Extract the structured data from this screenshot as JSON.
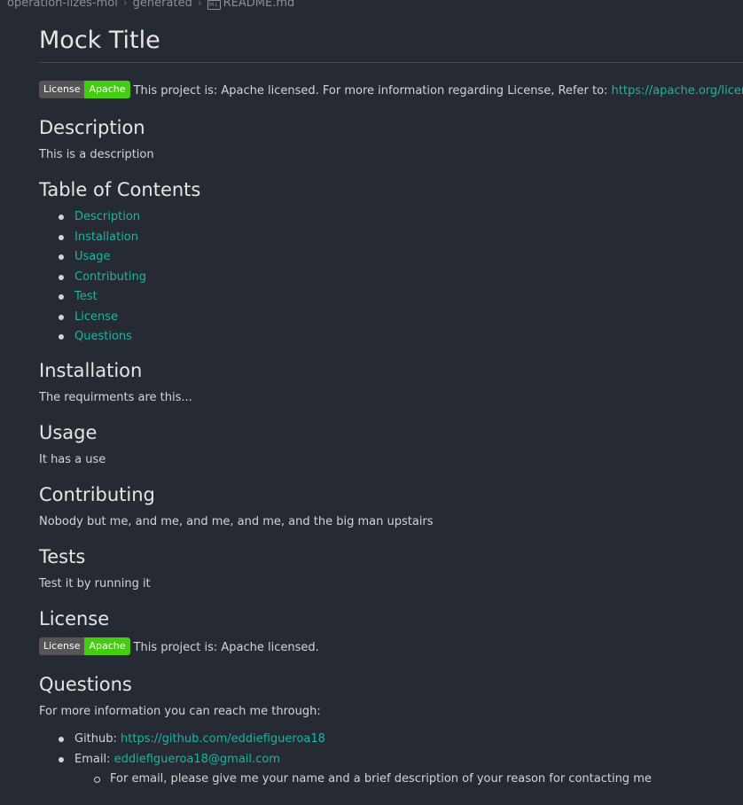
{
  "breadcrumb": {
    "folder1": "operation-lizes-moi",
    "folder2": "generated",
    "file_icon": "M↓",
    "file": "README.md"
  },
  "doc": {
    "title": "Mock Title",
    "badge": {
      "left": "License",
      "right": "Apache"
    },
    "license_intro": "This project is: Apache licensed. For more information regarding License, Refer to:",
    "license_link": "https://apache.org/licenses/",
    "description_heading": "Description",
    "description_text": "This is a description",
    "toc_heading": "Table of Contents",
    "toc": [
      "Description",
      "Installation",
      "Usage",
      "Contributing",
      "Test",
      "License",
      "Questions"
    ],
    "installation_heading": "Installation",
    "installation_text": "The requirments are this...",
    "usage_heading": "Usage",
    "usage_text": "It has a use",
    "contributing_heading": "Contributing",
    "contributing_text": "Nobody but me, and me, and me, and me, and the big man upstairs",
    "tests_heading": "Tests",
    "tests_text": "Test it by running it",
    "license_heading": "License",
    "license_short": "This project is: Apache licensed.",
    "questions_heading": "Questions",
    "questions_text": "For more information you can reach me through:",
    "github_label": "Github:",
    "github_link": "https://github.com/eddiefigueroa18",
    "email_label": "Email:",
    "email_link": "eddiefigueroa18@gmail.com",
    "email_note": "For email, please give me your name and a brief description of your reason for contacting me"
  },
  "colors": {
    "background": "#262a33",
    "link": "#1bb5a1",
    "badge_left": "#555555",
    "badge_right": "#44cc11"
  }
}
